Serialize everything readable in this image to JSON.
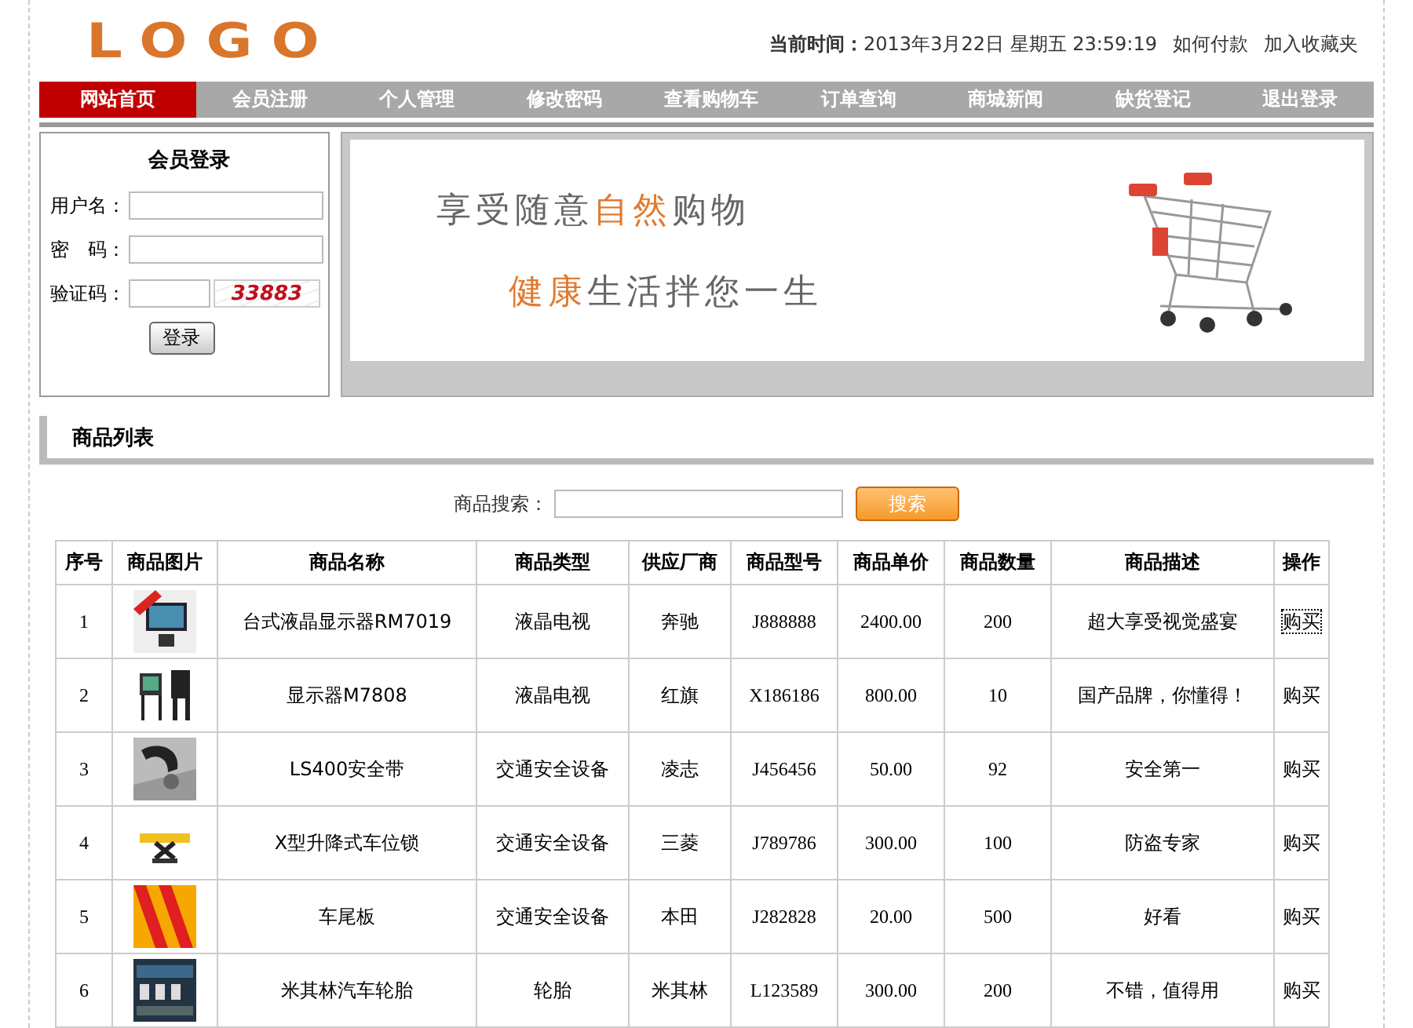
{
  "header": {
    "logo": "LOGO",
    "time_label": "当前时间：",
    "time_value": "2013年3月22日 星期五 23:59:19",
    "links": [
      "如何付款",
      "加入收藏夹"
    ]
  },
  "nav": [
    {
      "label": "网站首页",
      "selected": true
    },
    {
      "label": "会员注册",
      "selected": false
    },
    {
      "label": "个人管理",
      "selected": false
    },
    {
      "label": "修改密码",
      "selected": false
    },
    {
      "label": "查看购物车",
      "selected": false
    },
    {
      "label": "订单查询",
      "selected": false
    },
    {
      "label": "商城新闻",
      "selected": false
    },
    {
      "label": "缺货登记",
      "selected": false
    },
    {
      "label": "退出登录",
      "selected": false
    }
  ],
  "login": {
    "title": "会员登录",
    "fields": [
      {
        "label": "用户名：",
        "kind": "text"
      },
      {
        "label": "密　码：",
        "kind": "text"
      },
      {
        "label": "验证码：",
        "kind": "captcha",
        "captcha": "33883"
      }
    ],
    "button": "登录"
  },
  "banner": {
    "lines": [
      [
        {
          "text": "享受随意",
          "highlight": false
        },
        {
          "text": "自然",
          "highlight": true
        },
        {
          "text": "购物",
          "highlight": false
        }
      ],
      [
        {
          "text": "健康",
          "highlight": true
        },
        {
          "text": "生活拌您一生",
          "highlight": false
        }
      ]
    ]
  },
  "product_list": {
    "title": "商品列表",
    "search_label": "商品搜索：",
    "search_button": "搜索"
  },
  "table": {
    "columns": [
      "序号",
      "商品图片",
      "商品名称",
      "商品类型",
      "供应厂商",
      "商品型号",
      "商品单价",
      "商品数量",
      "商品描述",
      "操作"
    ],
    "rows": [
      {
        "no": "1",
        "name": "台式液晶显示器RM7019",
        "type": "液晶电视",
        "vendor": "奔驰",
        "model": "J888888",
        "price": "2400.00",
        "qty": "200",
        "desc": "超大享受视觉盛宴",
        "action": "购买",
        "focused": true
      },
      {
        "no": "2",
        "name": "显示器M7808",
        "type": "液晶电视",
        "vendor": "红旗",
        "model": "X186186",
        "price": "800.00",
        "qty": "10",
        "desc": "国产品牌，你懂得！",
        "action": "购买",
        "focused": false
      },
      {
        "no": "3",
        "name": "LS400安全带",
        "type": "交通安全设备",
        "vendor": "凌志",
        "model": "J456456",
        "price": "50.00",
        "qty": "92",
        "desc": "安全第一",
        "action": "购买",
        "focused": false
      },
      {
        "no": "4",
        "name": "X型升降式车位锁",
        "type": "交通安全设备",
        "vendor": "三菱",
        "model": "J789786",
        "price": "300.00",
        "qty": "100",
        "desc": "防盗专家",
        "action": "购买",
        "focused": false
      },
      {
        "no": "5",
        "name": "车尾板",
        "type": "交通安全设备",
        "vendor": "本田",
        "model": "J282828",
        "price": "20.00",
        "qty": "500",
        "desc": "好看",
        "action": "购买",
        "focused": false
      },
      {
        "no": "6",
        "name": "米其林汽车轮胎",
        "type": "轮胎",
        "vendor": "米其林",
        "model": "L123589",
        "price": "300.00",
        "qty": "200",
        "desc": "不错，值得用",
        "action": "购买",
        "focused": false
      }
    ]
  }
}
